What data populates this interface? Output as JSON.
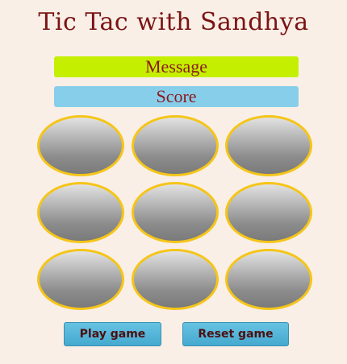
{
  "title": "Tic Tac with Sandhya",
  "message": {
    "label": "Message",
    "color": "#c4f000"
  },
  "score": {
    "label": "Score",
    "color": "#87ceeb"
  },
  "board": {
    "cells": [
      "",
      "",
      "",
      "",
      "",
      "",
      "",
      "",
      ""
    ],
    "cell_border_color": "#f5c518"
  },
  "buttons": {
    "play_label": "Play game",
    "reset_label": "Reset game"
  }
}
